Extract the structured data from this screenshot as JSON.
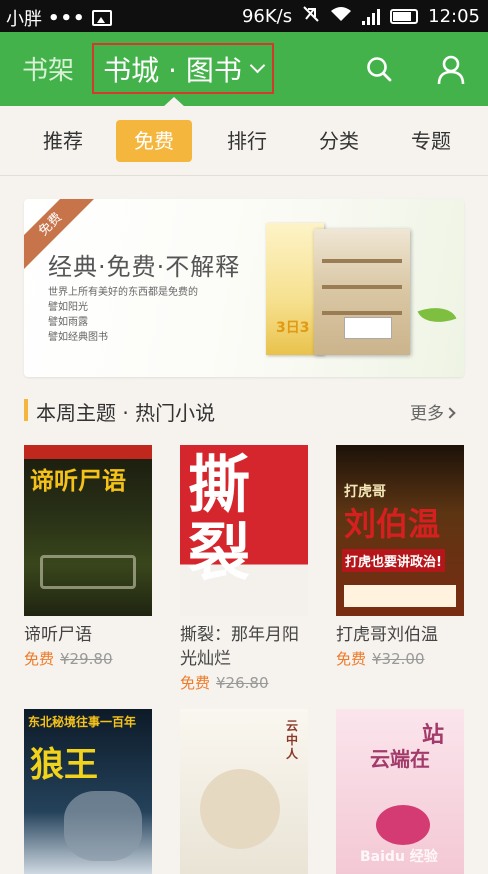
{
  "status_bar": {
    "carrier": "小胖",
    "dots": "•••",
    "speed": "96K/s",
    "time": "12:05"
  },
  "header": {
    "brand": "书架",
    "store_label": "书城 · 图书",
    "accent_color": "#43b24a"
  },
  "subnav": {
    "tabs": [
      {
        "label": "推荐"
      },
      {
        "label": "免费"
      },
      {
        "label": "排行"
      },
      {
        "label": "分类"
      },
      {
        "label": "专题"
      }
    ],
    "active_index": 1
  },
  "banner": {
    "ribbon": "免费",
    "title": "经典·免费·不解释",
    "lines": [
      "世界上所有美好的东西都是免费的",
      "譬如阳光",
      "譬如雨露",
      "譬如经典图书"
    ],
    "book_a_text": "3日3"
  },
  "section": {
    "title": "本周主题 · 热门小说",
    "more": "更多"
  },
  "books": [
    {
      "name": "谛听尸语",
      "free": "免费",
      "price": "¥29.80",
      "cover_title": "谛听尸语"
    },
    {
      "name": "撕裂：那年月阳光灿烂",
      "free": "免费",
      "price": "¥26.80",
      "cover_title": "撕裂"
    },
    {
      "name": "打虎哥刘伯温",
      "free": "免费",
      "price": "¥32.00",
      "cover_title": "打虎哥",
      "cover_title_2": "刘伯温",
      "cover_slogan": "打虎也要讲政治!"
    },
    {
      "cover_title": "东北秘境往事一百年",
      "cover_title_2": "狼王"
    },
    {
      "cover_title": "云中人"
    },
    {
      "cover_title": "站",
      "cover_title_2": "云端在"
    }
  ],
  "watermark": "Baidu 经验"
}
